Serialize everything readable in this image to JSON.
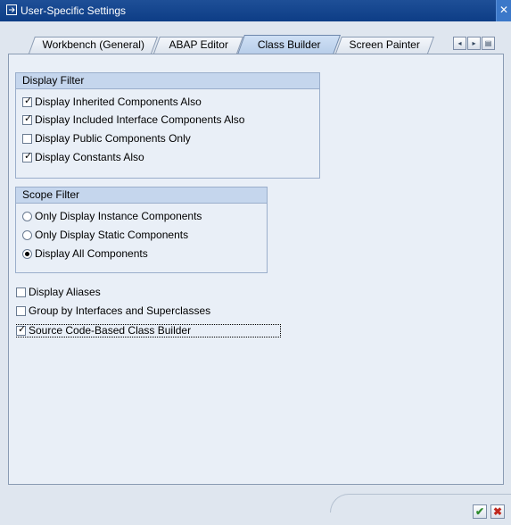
{
  "window": {
    "title": "User-Specific Settings",
    "close_glyph": "✕"
  },
  "tabs": [
    {
      "label": "Workbench (General)"
    },
    {
      "label": "ABAP Editor"
    },
    {
      "label": "Class Builder"
    },
    {
      "label": "Screen Painter"
    }
  ],
  "tab_nav": {
    "prev_glyph": "◂",
    "next_glyph": "▸",
    "list_glyph": "▤"
  },
  "display_filter": {
    "title": "Display Filter",
    "items": [
      {
        "label": "Display Inherited Components Also",
        "checked": true
      },
      {
        "label": "Display Included Interface Components Also",
        "checked": true
      },
      {
        "label": "Display Public Components Only",
        "checked": false
      },
      {
        "label": "Display Constants Also",
        "checked": true
      }
    ]
  },
  "scope_filter": {
    "title": "Scope Filter",
    "items": [
      {
        "label": "Only Display Instance Components",
        "selected": false
      },
      {
        "label": "Only Display Static Components",
        "selected": false
      },
      {
        "label": "Display All Components",
        "selected": true
      }
    ]
  },
  "options": [
    {
      "label": "Display Aliases",
      "checked": false
    },
    {
      "label": "Group by Interfaces and Superclasses",
      "checked": false
    },
    {
      "label": "Source Code-Based Class Builder",
      "checked": true
    }
  ],
  "footer": {
    "ok_glyph": "✔",
    "cancel_glyph": "✖"
  },
  "colors": {
    "title_bar": "#0d3d86",
    "ok": "#2e8b2e",
    "cancel": "#c0281e"
  }
}
